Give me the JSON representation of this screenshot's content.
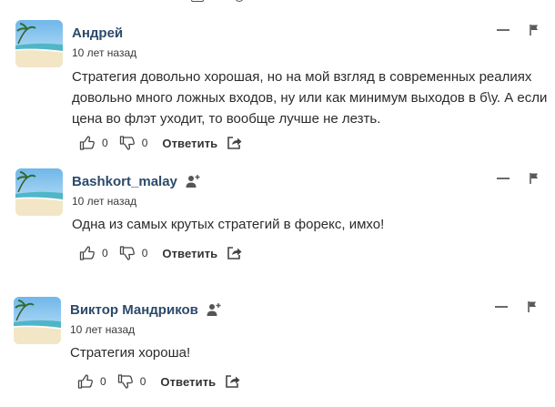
{
  "comments": [
    {
      "author": "Андрей",
      "has_follow_icon": false,
      "time": "10 лет назад",
      "text": "Стратегия довольно хорошая, но на мой взгляд в современных реалиях довольно много ложных входов, ну или как минимум выходов в б\\у. А если цена во флэт уходит, то вообще лучше не лезть.",
      "likes": "0",
      "dislikes": "0",
      "reply_label": "Ответить"
    },
    {
      "author": "Bashkort_malay",
      "has_follow_icon": true,
      "time": "10 лет назад",
      "text": "Одна из самых крутых стратегий в форекс, имхо!",
      "likes": "0",
      "dislikes": "0",
      "reply_label": "Ответить"
    },
    {
      "author": "Виктор Мандриков",
      "has_follow_icon": true,
      "time": "10 лет назад",
      "text": "Стратегия хороша!",
      "likes": "0",
      "dislikes": "0",
      "reply_label": "Ответить"
    }
  ],
  "icons": {
    "avatar": "beach-avatar-icon",
    "follow": "add-user-icon",
    "minimize": "minimize-icon",
    "flag": "flag-icon",
    "like": "thumbs-up-icon",
    "dislike": "thumbs-down-icon",
    "share": "share-icon"
  },
  "colors": {
    "author": "#2c4a6a",
    "text": "#2b2b2b",
    "icon": "#555555"
  }
}
